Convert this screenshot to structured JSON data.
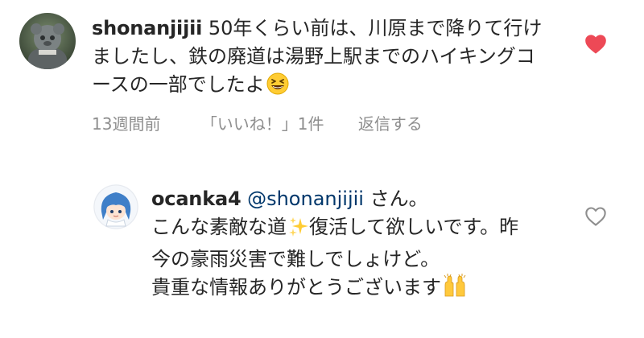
{
  "colors": {
    "text": "#262626",
    "meta": "#8e8e8e",
    "mention": "#00376b",
    "liked": "#ed4956"
  },
  "comments": [
    {
      "username": "shonanjijii",
      "text": "50年くらい前は、川原まで降りて行けましたし、鉄の廃道は湯野上駅までのハイキングコースの一部でしたよ",
      "emoji": "grinning-squinting-face-emoji",
      "time": "13週間前",
      "likes": "「いいね！」1件",
      "reply_label": "返信する",
      "liked": true,
      "like_icon": "heart-filled-icon"
    },
    {
      "username": "ocanka4",
      "mention": "@shonanjijii",
      "line1_suffix": " さん。",
      "text_part1": "こんな素敵な道",
      "emoji_inline": "sparkles-emoji",
      "text_part2": "復活して欲しいです。昨今の豪雨災害で難しでしょけど。",
      "text_line_last": "貴重な情報ありがとうございます",
      "emoji_end": "raising-hands-emoji",
      "liked": false,
      "like_icon": "heart-outline-icon"
    }
  ]
}
